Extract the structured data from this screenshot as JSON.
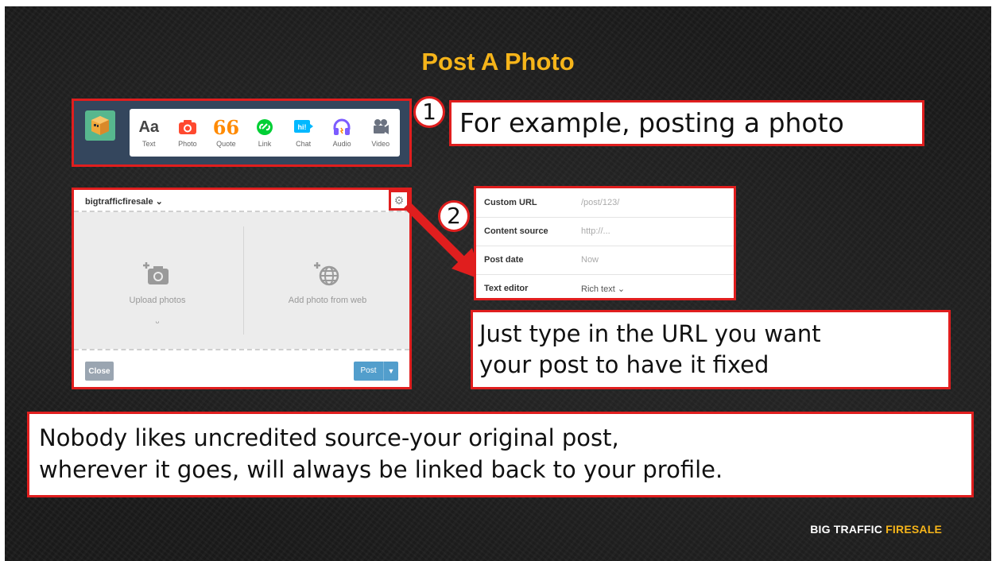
{
  "slide": {
    "title": "Post A Photo",
    "footer_brand": "BIG TRAFFIC",
    "footer_accent": "FIRESALE",
    "accent_color": "#f5b41a",
    "highlight_color": "#e01e1e"
  },
  "toolbar": {
    "avatar_icon": "cube-avatar-icon",
    "items": [
      {
        "label": "Text",
        "glyph": "Aa",
        "icon": "text-icon",
        "color": "#444444"
      },
      {
        "label": "Photo",
        "glyph": "",
        "icon": "camera-icon",
        "color": "#ff492f"
      },
      {
        "label": "Quote",
        "glyph": "66",
        "icon": "quote-icon",
        "color": "#ff8a00"
      },
      {
        "label": "Link",
        "glyph": "",
        "icon": "link-icon",
        "color": "#00cf35"
      },
      {
        "label": "Chat",
        "glyph": "hi!",
        "icon": "chat-icon",
        "color": "#00b8ff"
      },
      {
        "label": "Audio",
        "glyph": "",
        "icon": "headphones-icon",
        "color": "#7c5cff"
      },
      {
        "label": "Video",
        "glyph": "",
        "icon": "video-camera-icon",
        "color": "#6b7280"
      }
    ]
  },
  "callouts": {
    "step1_number": "1",
    "step1_text": "For example, posting a photo",
    "step2_number": "2",
    "step2_text_line1": "Just type in the URL you want",
    "step2_text_line2": "your post to have it fixed",
    "bottom_line1": "Nobody likes uncredited source-your original post,",
    "bottom_line2": "wherever it goes, will always be linked back to your profile."
  },
  "dialog": {
    "blog_name": "bigtrafficfiresale",
    "upload_label": "Upload photos",
    "web_label": "Add photo from web",
    "smiley": "ᵕ",
    "close_label": "Close",
    "post_label": "Post"
  },
  "settings": {
    "rows": [
      {
        "label": "Custom URL",
        "value": "/post/123/"
      },
      {
        "label": "Content source",
        "value": "http://..."
      },
      {
        "label": "Post date",
        "value": "Now"
      },
      {
        "label": "Text editor",
        "value": "Rich text"
      }
    ]
  }
}
